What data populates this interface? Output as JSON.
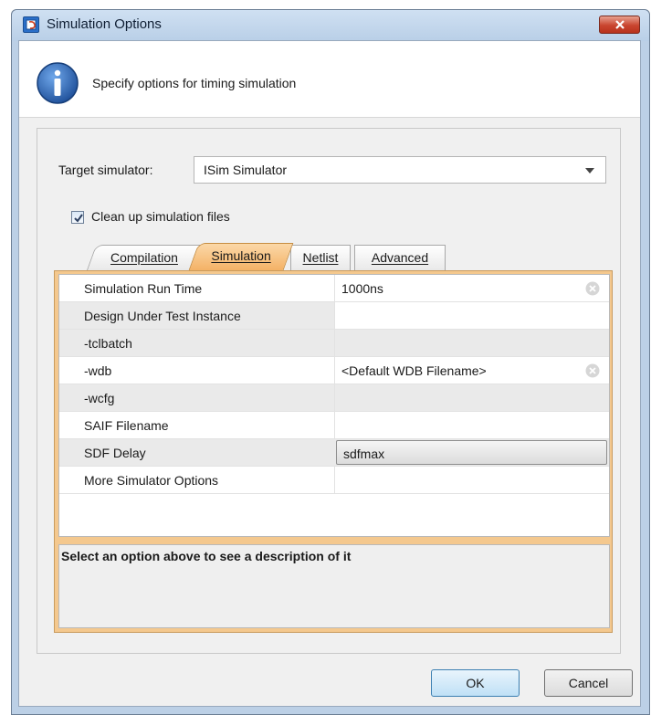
{
  "window": {
    "title": "Simulation Options"
  },
  "header": {
    "text": "Specify options for timing simulation"
  },
  "target": {
    "label": "Target simulator:",
    "value": "ISim Simulator"
  },
  "cleanup": {
    "label": "Clean up simulation files",
    "checked": true
  },
  "tabs": [
    {
      "label": "Compilation"
    },
    {
      "label": "Simulation",
      "selected": true
    },
    {
      "label": "Netlist"
    },
    {
      "label": "Advanced"
    }
  ],
  "properties": [
    {
      "name": "Simulation Run Time",
      "value": "1000ns"
    },
    {
      "name": "Design Under Test Instance",
      "value": ""
    },
    {
      "name": "-tclbatch",
      "value": ""
    },
    {
      "name": "-wdb",
      "value": "<Default WDB Filename>"
    },
    {
      "name": "-wcfg",
      "value": ""
    },
    {
      "name": "SAIF Filename",
      "value": ""
    },
    {
      "name": "SDF Delay",
      "value": "sdfmax"
    },
    {
      "name": "More Simulator Options",
      "value": ""
    }
  ],
  "description": "Select an option above to see a description of it",
  "buttons": {
    "ok": "OK",
    "cancel": "Cancel"
  },
  "colors": {
    "selected_tab": "#f4b266",
    "panel": "#f4c88e"
  }
}
